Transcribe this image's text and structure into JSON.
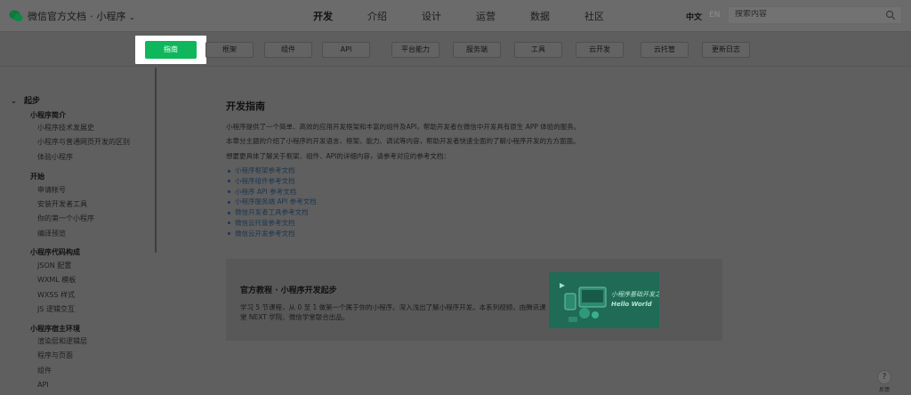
{
  "header": {
    "brand_title": "微信官方文档",
    "brand_sep": "·",
    "brand_product": "小程序",
    "nav": [
      {
        "label": "开发",
        "active": true
      },
      {
        "label": "介绍",
        "active": false
      },
      {
        "label": "设计",
        "active": false
      },
      {
        "label": "运营",
        "active": false
      },
      {
        "label": "数据",
        "active": false
      },
      {
        "label": "社区",
        "active": false
      }
    ],
    "lang_zh": "中文",
    "lang_en": "EN",
    "search_placeholder": "搜索内容"
  },
  "subnav": {
    "tabs": [
      "指南",
      "框架",
      "组件",
      "API",
      "平台能力",
      "服务端",
      "工具",
      "云开发",
      "云托管",
      "更新日志"
    ]
  },
  "sidebar": {
    "root": "起步",
    "groups": [
      {
        "title": "小程序简介",
        "items": [
          "小程序技术发展史",
          "小程序与普通网页开发的区别",
          "体验小程序"
        ]
      },
      {
        "title": "开始",
        "items": [
          "申请帐号",
          "安装开发者工具",
          "你的第一个小程序",
          "编译预览"
        ]
      },
      {
        "title": "小程序代码构成",
        "items": [
          "JSON 配置",
          "WXML 模板",
          "WXSS 样式",
          "JS 逻辑交互"
        ]
      },
      {
        "title": "小程序宿主环境",
        "items": [
          "渲染层和逻辑层",
          "程序与页面",
          "组件",
          "API"
        ]
      }
    ]
  },
  "content": {
    "title": "开发指南",
    "p1": "小程序提供了一个简单、高效的应用开发框架和丰富的组件及API，帮助开发者在微信中开发具有原生 APP 体验的服务。",
    "p2": "本章分主题的介绍了小程序的开发语言、框架、能力、调试等内容，帮助开发者快速全面的了解小程序开发的方方面面。",
    "p3": "想要更具体了解关于框架、组件、API的详细内容，请参考对应的参考文档：",
    "links": [
      "小程序框架参考文档",
      "小程序组件参考文档",
      "小程序 API 参考文档",
      "小程序服务端 API 参考文档",
      "微信开发者工具参考文档",
      "微信云托管参考文档",
      "微信云开发参考文档"
    ]
  },
  "card": {
    "title": "官方教程 · 小程序开发起步",
    "desc": "学习 5 节课程，从 0 至 1 做第一个属于你的小程序。深入浅出了解小程序开发。本系列视频，由腾讯课堂 NEXT 学院、微信学堂联合出品。",
    "banner_line1": "小程序基础开发之",
    "banner_line2": "Hello World"
  },
  "help": {
    "label": "反馈"
  },
  "colors": {
    "accent": "#0fb75c",
    "overlay_bg": "#5f5f5f",
    "link": "#1d3550"
  }
}
